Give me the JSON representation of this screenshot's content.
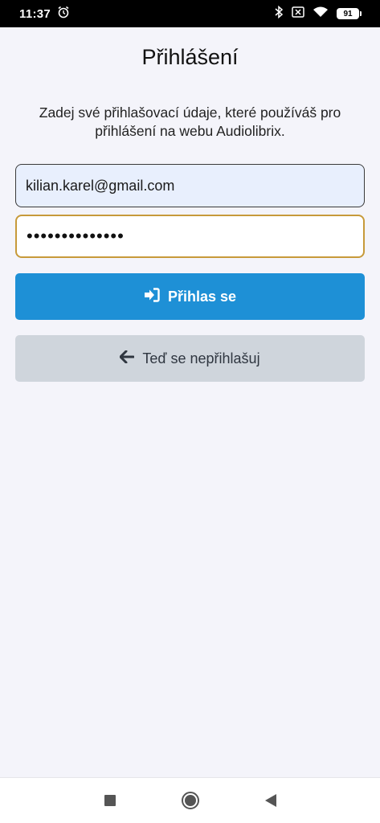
{
  "status_bar": {
    "time": "11:37",
    "battery": "91",
    "icons": [
      "alarm-icon",
      "bluetooth-icon",
      "no-sim-icon",
      "wifi-icon",
      "battery-icon"
    ]
  },
  "login": {
    "title": "Přihlášení",
    "intro": "Zadej své přihlašovací údaje, které používáš pro přihlášení na webu Audiolibrix.",
    "email_value": "kilian.karel@gmail.com",
    "password_value": "••••••••••••••",
    "login_button_label": "Přihlas se",
    "login_button_icon": "sign-in-icon",
    "skip_button_label": "Teď se nepřihlašuj",
    "skip_button_icon": "arrow-left-icon"
  },
  "colors": {
    "background": "#f4f4fa",
    "primary_button": "#1e90d6",
    "secondary_button": "#cfd5dc",
    "email_field_bg": "#e8effd",
    "focus_border": "#c79a3a"
  },
  "nav_bar": {
    "icons": [
      "recents-square-icon",
      "home-circle-icon",
      "back-triangle-icon"
    ]
  }
}
